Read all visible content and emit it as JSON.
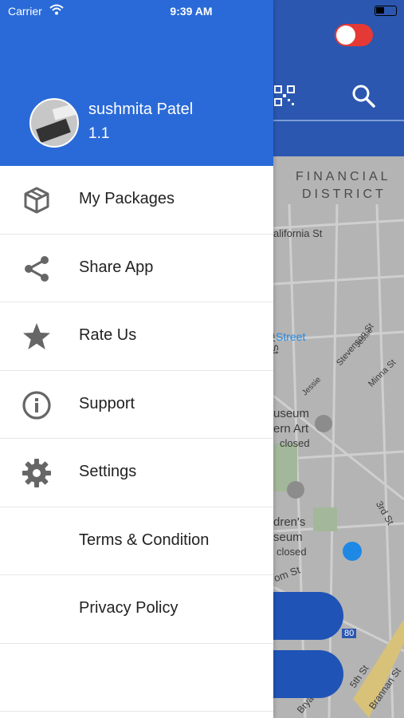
{
  "status_bar": {
    "carrier": "Carrier",
    "time": "9:39 AM"
  },
  "drawer": {
    "user": {
      "name": "sushmita Patel",
      "subtitle": "1.1"
    },
    "items": [
      {
        "label": "My Packages",
        "icon": "package-icon"
      },
      {
        "label": "Share App",
        "icon": "share-icon"
      },
      {
        "label": "Rate Us",
        "icon": "star-icon"
      },
      {
        "label": "Support",
        "icon": "info-icon"
      },
      {
        "label": "Settings",
        "icon": "gear-icon"
      },
      {
        "label": "Terms & Condition",
        "icon": ""
      },
      {
        "label": "Privacy Policy",
        "icon": ""
      }
    ]
  },
  "map": {
    "labels": {
      "district_1": "FINANCIAL",
      "district_2": "DISTRICT",
      "california": "alifornia St",
      "montgomery": "Montgomery St",
      "street": "Street",
      "stevenson": "Stevenson St",
      "jessie_1": "Jessie",
      "minna": "Minna St",
      "jessie_2": "Jessie",
      "museum_1": "useum",
      "museum_2": "ern Art",
      "closed_1": "closed",
      "third": "3rd St",
      "childrens_1": "dren's",
      "childrens_2": "seum",
      "closed_2": "closed",
      "om": "om St",
      "fifth": "5th St",
      "brannan": "Brannan St",
      "bryant": "Bryant",
      "i80": "80"
    }
  },
  "colors": {
    "drawer_header": "#2a6ad8",
    "app_header": "#2b57b0",
    "toggle": "#e53935",
    "map_button": "#1f53b5"
  }
}
